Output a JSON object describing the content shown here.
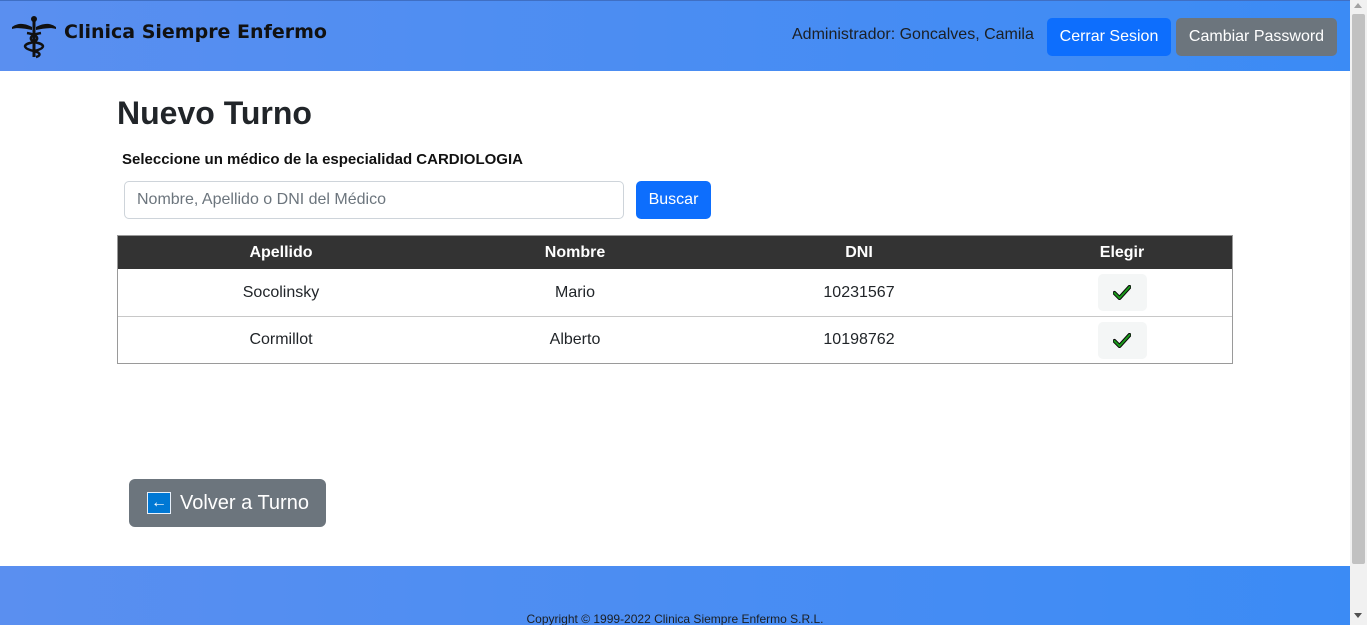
{
  "header": {
    "brand_title": "Clinica Siempre Enfermo",
    "logo_icon": "caduceus-icon",
    "admin_label": "Administrador: Goncalves, Camila",
    "logout_label": "Cerrar Sesion",
    "change_password_label": "Cambiar Password"
  },
  "main": {
    "title": "Nuevo Turno",
    "select_label": "Seleccione un médico de la especialidad CARDIOLOGIA",
    "search": {
      "placeholder": "Nombre, Apellido o DNI del Médico",
      "value": ""
    },
    "search_button_label": "Buscar"
  },
  "table": {
    "columns": [
      "Apellido",
      "Nombre",
      "DNI",
      "Elegir"
    ],
    "rows": [
      {
        "apellido": "Socolinsky",
        "nombre": "Mario",
        "dni": "10231567",
        "action_icon": "check-icon"
      },
      {
        "apellido": "Cormillot",
        "nombre": "Alberto",
        "dni": "10198762",
        "action_icon": "check-icon"
      }
    ]
  },
  "back_button": {
    "label": "Volver a Turno",
    "icon": "left-arrow-icon"
  },
  "footer": {
    "copyright": "Copyright © 1999-2022 Clinica Siempre Enfermo S.R.L."
  },
  "colors": {
    "header_gradient_start": "#5a8ff0",
    "header_gradient_end": "#3b8bf5",
    "primary_button": "#0d6efd",
    "secondary_button": "#6c757d",
    "table_header": "#333333",
    "check_green": "#1a7a1a"
  }
}
